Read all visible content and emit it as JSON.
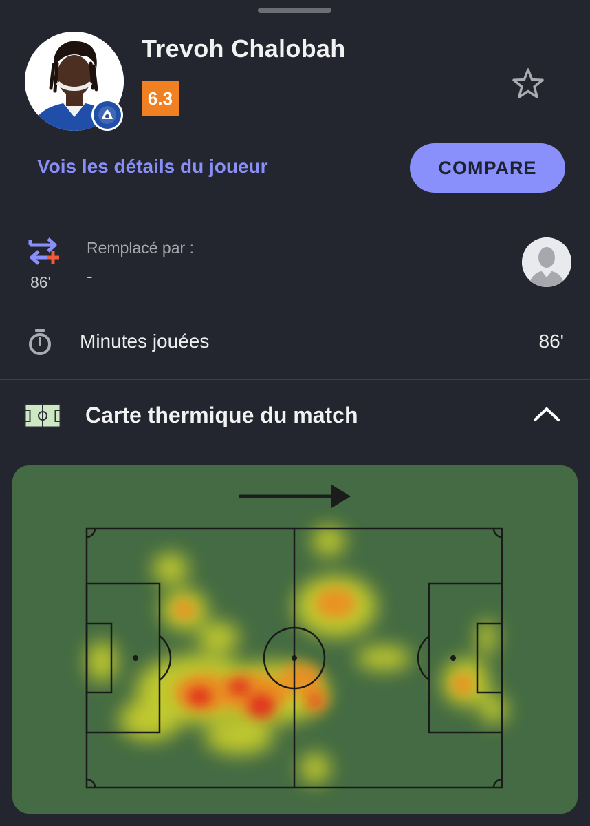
{
  "player": {
    "name": "Trevoh Chalobah",
    "rating": "6.3",
    "rating_color": "#f08022"
  },
  "actions": {
    "details_link": "Vois les détails du joueur",
    "compare_button": "COMPARE",
    "favorite_icon": "star-outline-icon"
  },
  "substitution": {
    "icon": "substitution-arrows-icon",
    "minute": "86'",
    "label": "Remplacé par :",
    "value": "-"
  },
  "minutes": {
    "icon": "stopwatch-icon",
    "label": "Minutes jouées",
    "value": "86'"
  },
  "heatmap": {
    "icon": "pitch-icon",
    "title": "Carte thermique du match",
    "toggle_icon": "chevron-up-icon",
    "direction_icon": "arrow-right-icon"
  },
  "colors": {
    "background": "#23262e",
    "accent": "#8a90fb",
    "pitch": "#446b43",
    "heat_high": "#e0281e",
    "heat_mid": "#f08a22",
    "heat_low": "#d6d92a"
  }
}
